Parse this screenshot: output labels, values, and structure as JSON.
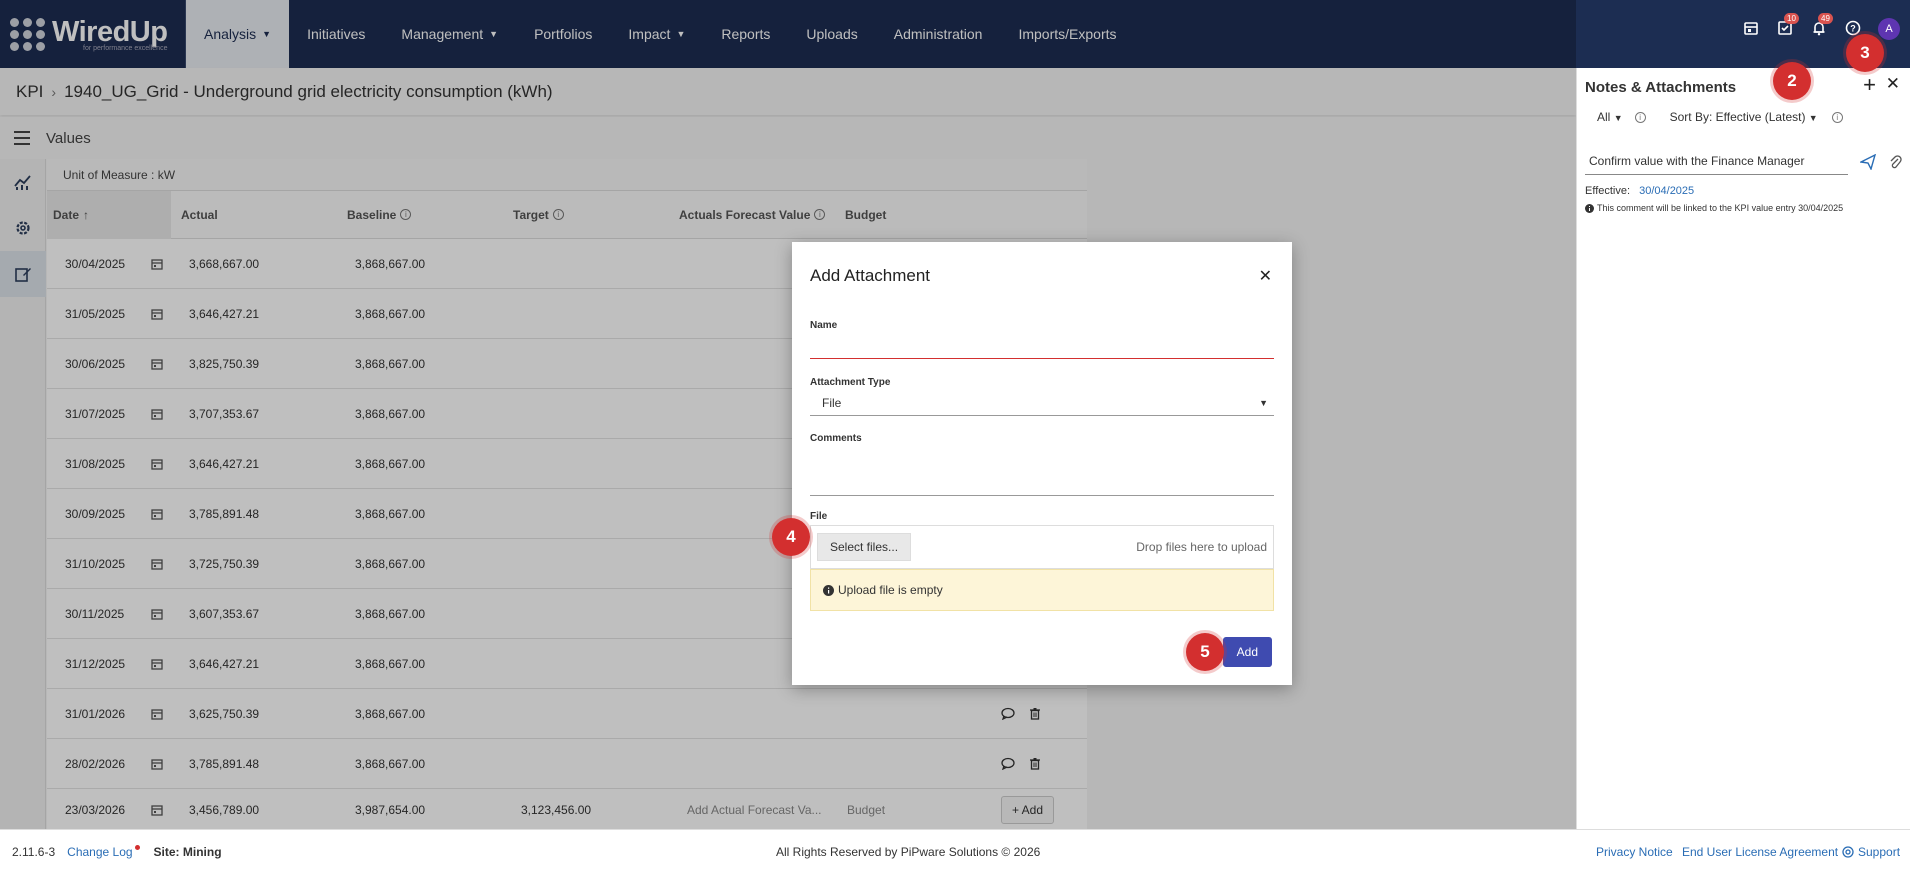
{
  "nav": {
    "logo_text": "WiredUp",
    "logo_sub": "for performance excellence",
    "items": [
      {
        "label": "Analysis",
        "caret": true,
        "active": true
      },
      {
        "label": "Initiatives",
        "caret": false
      },
      {
        "label": "Management",
        "caret": true
      },
      {
        "label": "Portfolios",
        "caret": false
      },
      {
        "label": "Impact",
        "caret": true
      },
      {
        "label": "Reports",
        "caret": false
      },
      {
        "label": "Uploads",
        "caret": false
      },
      {
        "label": "Administration",
        "caret": false
      },
      {
        "label": "Imports/Exports",
        "caret": false
      }
    ],
    "tasks_badge": "10",
    "notifications_badge": "49",
    "avatar_initial": "A"
  },
  "breadcrumb": {
    "root": "KPI",
    "title": "1940_UG_Grid - Underground grid electricity consumption (kWh)"
  },
  "values": {
    "title": "Values",
    "unit_of_measure": "Unit of Measure : kW"
  },
  "table": {
    "columns": {
      "date": "Date",
      "actual": "Actual",
      "baseline": "Baseline",
      "target": "Target",
      "afv": "Actuals Forecast Value",
      "budget": "Budget"
    },
    "rows": [
      {
        "date": "30/04/2025",
        "actual": "3,668,667.00",
        "baseline": "3,868,667.00"
      },
      {
        "date": "31/05/2025",
        "actual": "3,646,427.21",
        "baseline": "3,868,667.00"
      },
      {
        "date": "30/06/2025",
        "actual": "3,825,750.39",
        "baseline": "3,868,667.00"
      },
      {
        "date": "31/07/2025",
        "actual": "3,707,353.67",
        "baseline": "3,868,667.00"
      },
      {
        "date": "31/08/2025",
        "actual": "3,646,427.21",
        "baseline": "3,868,667.00"
      },
      {
        "date": "30/09/2025",
        "actual": "3,785,891.48",
        "baseline": "3,868,667.00"
      },
      {
        "date": "31/10/2025",
        "actual": "3,725,750.39",
        "baseline": "3,868,667.00"
      },
      {
        "date": "30/11/2025",
        "actual": "3,607,353.67",
        "baseline": "3,868,667.00"
      },
      {
        "date": "31/12/2025",
        "actual": "3,646,427.21",
        "baseline": "3,868,667.00"
      },
      {
        "date": "31/01/2026",
        "actual": "3,625,750.39",
        "baseline": "3,868,667.00"
      },
      {
        "date": "28/02/2026",
        "actual": "3,785,891.48",
        "baseline": "3,868,667.00"
      }
    ],
    "new_row": {
      "date": "23/03/2026",
      "actual": "3,456,789.00",
      "baseline": "3,987,654.00",
      "target": "3,123,456.00",
      "afv_placeholder": "Add Actual Forecast Va...",
      "budget_placeholder": "Budget",
      "add_label": "+ Add"
    }
  },
  "panel": {
    "title": "Notes & Attachments",
    "filter": "All",
    "sort": "Sort By: Effective (Latest)",
    "note_text": "Confirm value with the Finance Manager",
    "effective_label": "Effective:",
    "effective_date": "30/04/2025",
    "link_note": "This comment will be linked to the KPI value entry 30/04/2025"
  },
  "modal": {
    "title": "Add Attachment",
    "name_label": "Name",
    "name_value": "",
    "type_label": "Attachment Type",
    "type_value": "File",
    "comments_label": "Comments",
    "comments_value": "",
    "file_label": "File",
    "select_files": "Select files...",
    "drop_hint": "Drop files here to upload",
    "warning": "Upload file is empty",
    "add_button": "Add"
  },
  "markers": [
    "2",
    "3",
    "4",
    "5"
  ],
  "footer": {
    "version": "2.11.6-3",
    "changelog": "Change Log",
    "site": "Site: Mining",
    "copyright": "All Rights Reserved by PiPware Solutions © 2026",
    "privacy": "Privacy Notice",
    "eula": "End User License Agreement",
    "support": "Support"
  },
  "colors": {
    "nav_bg": "#1c2d52",
    "accent": "#3f4bb0",
    "marker": "#d32f2f",
    "link": "#2a6db5"
  }
}
